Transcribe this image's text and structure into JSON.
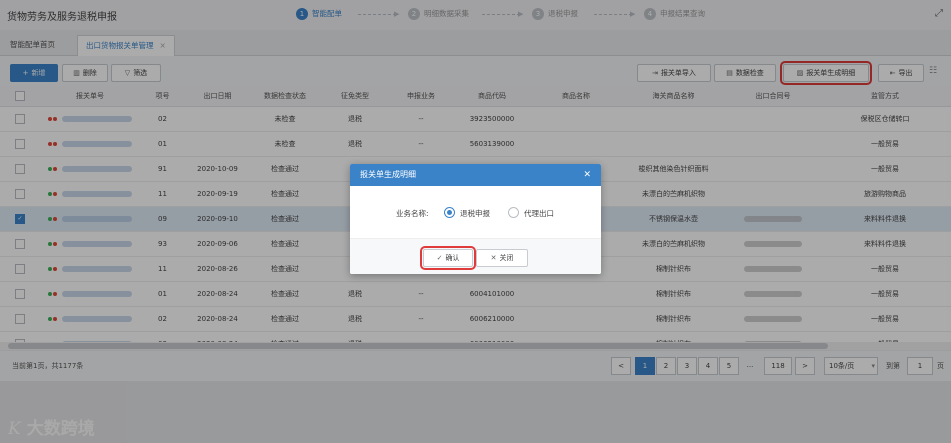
{
  "app": {
    "title": "货物劳务及服务退税申报"
  },
  "steps": [
    {
      "num": "1",
      "label": "智能配单",
      "active": true
    },
    {
      "num": "2",
      "label": "明细数据采集",
      "active": false
    },
    {
      "num": "3",
      "label": "退税申报",
      "active": false
    },
    {
      "num": "4",
      "label": "申报结果查询",
      "active": false
    }
  ],
  "tabs": [
    {
      "label": "智能配单首页"
    },
    {
      "label": "出口货物报关单管理"
    }
  ],
  "toolbar": {
    "add": "新增",
    "delete": "删除",
    "filter": "筛选",
    "import": "报关单导入",
    "check": "数据检查",
    "generate": "报关单生成明细",
    "export": "导出"
  },
  "table": {
    "columns": [
      "报关单号",
      "项号",
      "出口日期",
      "数据检查状态",
      "征免类型",
      "申报业务",
      "商品代码",
      "商品名称",
      "海关商品名称",
      "出口合同号",
      "监管方式"
    ],
    "rows": [
      {
        "item": "02",
        "date": "",
        "status": "未检查",
        "type": "退税",
        "biz": "--",
        "code": "3923500000",
        "name": "",
        "cname": "",
        "trade": "保税区仓储转口",
        "selected": false
      },
      {
        "item": "01",
        "date": "",
        "status": "未检查",
        "type": "退税",
        "biz": "--",
        "code": "5603139000",
        "name": "",
        "cname": "",
        "trade": "一般贸易",
        "selected": false
      },
      {
        "item": "91",
        "date": "2020-10-09",
        "status": "检查通过",
        "type": "",
        "biz": "",
        "code": "",
        "name": "",
        "cname": "梭织其他染色针织面料",
        "trade": "一般贸易",
        "selected": false
      },
      {
        "item": "11",
        "date": "2020-09-19",
        "status": "检查通过",
        "type": "",
        "biz": "",
        "code": "",
        "name": "",
        "cname": "未漂白的苎麻机织物",
        "trade": "旅游购物商品",
        "selected": false
      },
      {
        "item": "09",
        "date": "2020-09-10",
        "status": "检查通过",
        "type": "",
        "biz": "",
        "code": "",
        "name": "",
        "cname": "不锈钢保温水壶",
        "trade": "来料料件退换",
        "selected": true
      },
      {
        "item": "93",
        "date": "2020-09-06",
        "status": "检查通过",
        "type": "",
        "biz": "",
        "code": "",
        "name": "",
        "cname": "未漂白的苎麻机织物",
        "trade": "来料料件退换",
        "selected": false
      },
      {
        "item": "11",
        "date": "2020-08-26",
        "status": "检查通过",
        "type": "",
        "biz": "",
        "code": "",
        "name": "",
        "cname": "棉制针织布",
        "trade": "一般贸易",
        "selected": false
      },
      {
        "item": "01",
        "date": "2020-08-24",
        "status": "检查通过",
        "type": "退税",
        "biz": "--",
        "code": "6004101000",
        "name": "",
        "cname": "棉制针织布",
        "trade": "一般贸易",
        "selected": false
      },
      {
        "item": "02",
        "date": "2020-08-24",
        "status": "检查通过",
        "type": "退税",
        "biz": "--",
        "code": "6006210000",
        "name": "",
        "cname": "棉制针织布",
        "trade": "一般贸易",
        "selected": false
      },
      {
        "item": "03",
        "date": "2020-08-24",
        "status": "检查通过",
        "type": "退税",
        "biz": "--",
        "code": "6006210000",
        "name": "",
        "cname": "棉制针织布",
        "trade": "一般贸易",
        "selected": false
      }
    ]
  },
  "pager": {
    "summary": "当前第1页，共1177条",
    "pages": [
      "<",
      "1",
      "2",
      "3",
      "4",
      "5",
      "...",
      "118",
      ">"
    ],
    "page_size": "10条/页",
    "goto_label": "到第",
    "goto_value": "1",
    "unit": "页"
  },
  "modal": {
    "title": "报关单生成明细",
    "field_label": "业务名称:",
    "options": [
      "退税申报",
      "代理出口"
    ],
    "selected": "退税申报",
    "confirm": "确认",
    "close": "关闭"
  },
  "watermark": {
    "mark": "K",
    "text": "大数跨境"
  },
  "colors": {
    "primary": "#3b83c9",
    "highlight": "#e03b3b",
    "dot_red": "#e0493b",
    "dot_green": "#3bb25a"
  }
}
